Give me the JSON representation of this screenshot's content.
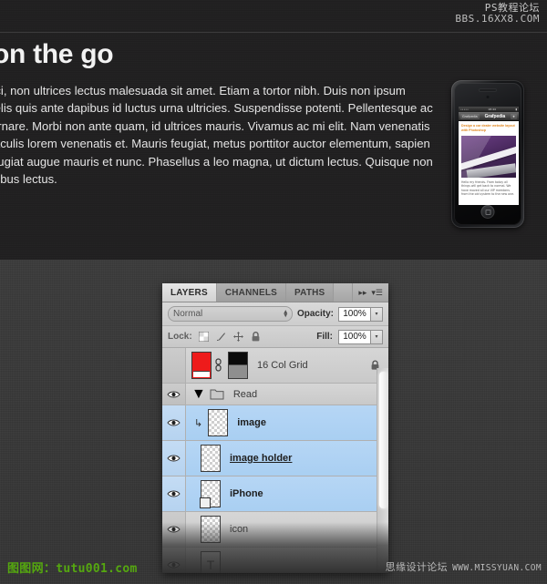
{
  "watermarks": {
    "top_line1": "PS教程论坛",
    "top_line2": "BBS.16XX8.COM",
    "bottom_left": "图图网：tutu001.com",
    "bottom_right_cn": "思缘设计论坛",
    "bottom_right_en": "WWW.MISSYUAN.COM",
    "accent_green": "#55a80f"
  },
  "hero": {
    "title": "on the go",
    "paragraph_lines": [
      "rci, non ultrices lectus malesuada sit amet. Etiam a tortor nibh. Duis non ipsum",
      "felis quis ante dapibus id luctus urna ultricies. Suspendisse potenti. Pellentesque ac",
      "ornare. Morbi non ante quam, id ultrices mauris. Vivamus ac mi elit. Nam venenatis",
      "iaculis lorem venenatis et. Mauris feugiat, metus porttitor auctor elementum, sapien",
      "eugiat augue mauris et nunc. Phasellus a leo magna, ut dictum lectus. Quisque non",
      "pibus lectus."
    ],
    "background_color": "#201f20",
    "text_color": "#e4e4e4"
  },
  "phone": {
    "status_left": "•••••",
    "status_time": "18:44",
    "nav_back": "Grafpedia",
    "nav_title": "Grafpedia",
    "nav_star": "★",
    "article_heading": "Design a car dealer website layout with Photoshop",
    "article_body": "Hello my friends. From today all things will get back to normal. We have moved all our VIP members from the old system to the new one.",
    "screen_bg": "#ffffff"
  },
  "layers_panel": {
    "tabs": [
      {
        "label": "LAYERS",
        "active": true
      },
      {
        "label": "CHANNELS",
        "active": false
      },
      {
        "label": "PATHS",
        "active": false
      }
    ],
    "collapse_icon": "▸▸",
    "menu_icon": "▾☰",
    "blend_mode": "Normal",
    "opacity_label": "Opacity:",
    "opacity_value": "100%",
    "lock_label": "Lock:",
    "lock_icons": [
      "transparency-lock-icon",
      "brush-lock-icon",
      "move-lock-icon",
      "all-lock-icon"
    ],
    "fill_label": "Fill:",
    "fill_value": "100%",
    "rows": [
      {
        "name": "16 Col Grid",
        "visible": false,
        "selected": false,
        "type": "layer",
        "thumb": "red",
        "has_mask": true,
        "has_link": true,
        "locked": true,
        "underline": false,
        "bold": false
      },
      {
        "name": "Read",
        "visible": true,
        "selected": false,
        "type": "group",
        "expanded": true
      },
      {
        "name": "image",
        "visible": true,
        "selected": true,
        "type": "layer",
        "thumb": "checker",
        "clipped": true,
        "underline": false,
        "bold": true
      },
      {
        "name": "image holder",
        "visible": true,
        "selected": true,
        "type": "layer",
        "thumb": "checker",
        "underline": true,
        "bold": true
      },
      {
        "name": "iPhone",
        "visible": true,
        "selected": true,
        "type": "layer",
        "thumb": "checker",
        "smart_object": true,
        "underline": false,
        "bold": true
      },
      {
        "name": "icon",
        "visible": true,
        "selected": false,
        "type": "layer",
        "thumb": "checker",
        "underline": false,
        "bold": false
      }
    ]
  }
}
